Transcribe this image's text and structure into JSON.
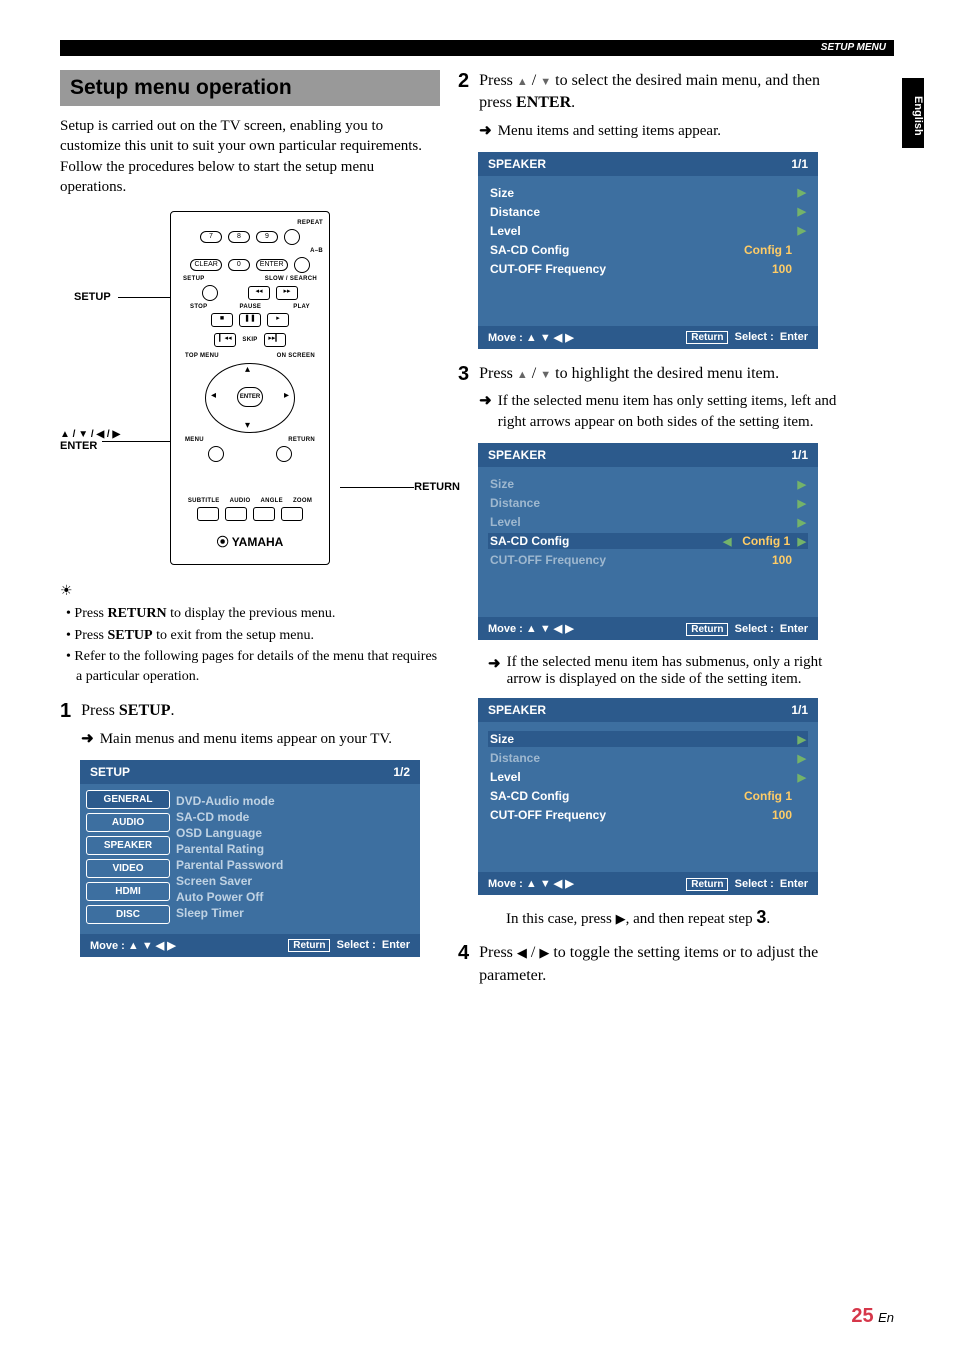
{
  "header": {
    "setup_menu": "SETUP MENU",
    "side_tab": "English"
  },
  "left": {
    "title": "Setup menu operation",
    "intro": "Setup is carried out on the TV screen, enabling you to customize this unit to suit your own particular requirements. Follow the procedures below to start the setup menu operations.",
    "remote": {
      "repeat": "REPEAT",
      "ab": "A–B",
      "clear": "CLEAR",
      "enter_btn": "ENTER",
      "setup_lbl": "SETUP",
      "slow_search": "SLOW / SEARCH",
      "stop": "STOP",
      "pause": "PAUSE",
      "play": "PLAY",
      "skip": "SKIP",
      "top_menu": "TOP MENU",
      "on_screen": "ON SCREEN",
      "enter_center": "ENTER",
      "menu": "MENU",
      "return": "RETURN",
      "subtitle": "SUBTITLE",
      "audio": "AUDIO",
      "angle": "ANGLE",
      "zoom": "ZOOM",
      "brand": "YAMAHA",
      "callout_setup": "SETUP",
      "callout_enter_top": "▲ / ▼ / ◀ / ▶",
      "callout_enter": "ENTER",
      "callout_return": "RETURN"
    },
    "tips": [
      "Press RETURN to display the previous menu.",
      "Press SETUP to exit from the setup menu.",
      "Refer to the following pages for details of the menu that requires a particular operation."
    ],
    "step1": {
      "num": "1",
      "text_pre": "Press ",
      "text_key": "SETUP",
      "text_post": ".",
      "sub": "Main menus and menu items appear on your TV."
    },
    "osd_setup": {
      "title": "SETUP",
      "page": "1/2",
      "tabs": [
        "GENERAL",
        "AUDIO",
        "SPEAKER",
        "VIDEO",
        "HDMI",
        "DISC"
      ],
      "items": [
        "DVD-Audio mode",
        "SA-CD mode",
        "OSD Language",
        "Parental Rating",
        "Parental Password",
        "Screen Saver",
        "Auto Power Off",
        "Sleep Timer"
      ],
      "move": "Move : ▲ ▼ ◀ ▶",
      "return": "Return",
      "select": "Select :",
      "enter": "Enter"
    }
  },
  "right": {
    "step2": {
      "num": "2",
      "line1_a": "Press ",
      "line1_b": " / ",
      "line1_c": " to select the desired main menu, and then press ",
      "line1_key": "ENTER",
      "line1_d": ".",
      "sub": "Menu items and setting items appear."
    },
    "osd_speaker1": {
      "title": "SPEAKER",
      "page": "1/1",
      "rows": [
        {
          "lbl": "Size",
          "val": "",
          "chev": true
        },
        {
          "lbl": "Distance",
          "val": "",
          "chev": true
        },
        {
          "lbl": "Level",
          "val": "",
          "chev": true
        },
        {
          "lbl": "SA-CD Config",
          "val": "Config 1",
          "chev": false
        },
        {
          "lbl": "CUT-OFF Frequency",
          "val": "100",
          "chev": false
        }
      ],
      "move": "Move : ▲ ▼ ◀ ▶",
      "return": "Return",
      "select": "Select :",
      "enter": "Enter"
    },
    "step3": {
      "num": "3",
      "line": "Press  ▲  /  ▼  to highlight the desired menu item.",
      "sub": "If the selected menu item has only setting items, left and right arrows appear on both sides of the setting item."
    },
    "osd_speaker2": {
      "title": "SPEAKER",
      "page": "1/1",
      "rows": [
        {
          "lbl": "Size",
          "val": "",
          "chev": true,
          "dim": true
        },
        {
          "lbl": "Distance",
          "val": "",
          "chev": true,
          "dim": true
        },
        {
          "lbl": "Level",
          "val": "",
          "chev": true,
          "dim": true
        },
        {
          "lbl": "SA-CD Config",
          "val": "Config 1",
          "sel": true,
          "lr": true
        },
        {
          "lbl": "CUT-OFF Frequency",
          "val": "100",
          "dim": true
        }
      ],
      "move": "Move : ▲ ▼ ◀ ▶",
      "return": "Return",
      "select": "Select :",
      "enter": "Enter"
    },
    "mid_note": "If the selected menu item has submenus, only a right arrow is displayed on the side of the setting item.",
    "osd_speaker3": {
      "title": "SPEAKER",
      "page": "1/1",
      "rows": [
        {
          "lbl": "Size",
          "val": "",
          "chev": true,
          "sel": true
        },
        {
          "lbl": "Distance",
          "val": "",
          "chev": true,
          "dim": true
        },
        {
          "lbl": "Level",
          "val": "",
          "chev": true
        },
        {
          "lbl": "SA-CD Config",
          "val": "Config 1"
        },
        {
          "lbl": "CUT-OFF Frequency",
          "val": "100"
        }
      ],
      "move": "Move : ▲ ▼ ◀ ▶",
      "return": "Return",
      "select": "Select :",
      "enter": "Enter"
    },
    "tail_note_a": "In this case, press ",
    "tail_note_b": ", and then repeat step ",
    "tail_note_step": "3",
    "tail_note_c": ".",
    "step4": {
      "num": "4",
      "line": "Press ◀ / ▶ to toggle the setting items or to adjust the parameter."
    }
  },
  "page": {
    "num": "25",
    "lang": "En"
  }
}
